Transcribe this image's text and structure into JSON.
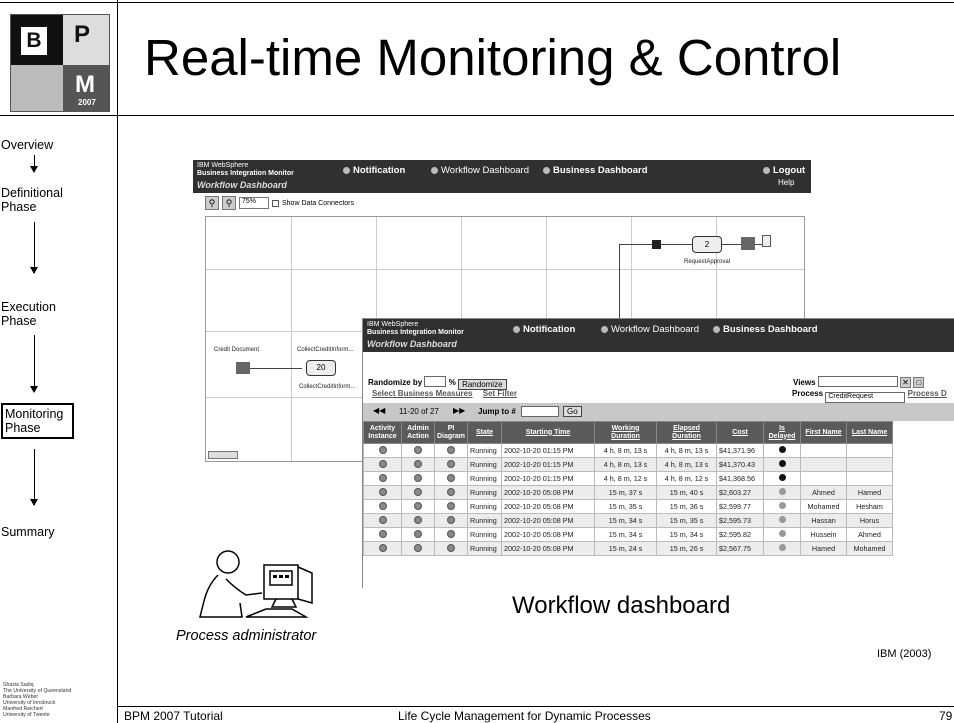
{
  "slide": {
    "title": "Real-time Monitoring & Control",
    "logo": {
      "letters": [
        "B",
        "P",
        "M"
      ],
      "year": "2007"
    },
    "footer": {
      "left": "BPM 2007 Tutorial",
      "center": "Life Cycle Management for Dynamic Processes",
      "page": "79"
    },
    "credits": [
      "Shazia Sadiq",
      "The University of Queensland",
      "Barbara Weber",
      "University of Innsbruck",
      "Manfred Reichert",
      "University of Twente"
    ],
    "caption_dashboard": "Workflow dashboard",
    "caption_admin": "Process administrator",
    "source": "IBM  (2003)"
  },
  "sidebar": {
    "items": [
      {
        "label": "Overview"
      },
      {
        "label": "Definitional Phase"
      },
      {
        "label": "Execution Phase"
      },
      {
        "label": "Monitoring Phase",
        "active": true
      },
      {
        "label": "Summary"
      }
    ]
  },
  "diagram_window": {
    "brand_line1": "IBM WebSphere",
    "brand_line2": "Business Integration Monitor",
    "subtitle": "Workflow Dashboard",
    "tabs": [
      "Notification",
      "Workflow Dashboard",
      "Business Dashboard"
    ],
    "logout": "Logout",
    "help": "Help",
    "zoom": "75%",
    "show_data_connectors": "Show Data Connectors",
    "nodes": {
      "credit_document": "Credit Document",
      "collect_credit_info": "CollectCreditInform...",
      "collect_count": "20",
      "request_approval": "RequestApproval",
      "approval_count": "2"
    }
  },
  "dashboard_window": {
    "brand_line1": "IBM WebSphere",
    "brand_line2": "Business Integration Monitor",
    "subtitle": "Workflow Dashboard",
    "tabs": [
      "Notification",
      "Workflow Dashboard",
      "Business Dashboard"
    ],
    "randomize_by_label": "Randomize by",
    "randomize_unit": "%",
    "randomize_button": "Randomize",
    "select_measures": "Select Business Measures",
    "set_filter": "Set Filter",
    "views_label": "Views",
    "process_label": "Process",
    "process_value": "CreditRequest",
    "process_link": "Process D",
    "pager_range": "11-20 of 27",
    "jump_to": "Jump to #",
    "go": "Go",
    "columns": [
      "Activity Instance",
      "Admin Action",
      "PI Diagram",
      "State",
      "Starting Time",
      "Working Duration",
      "Elapsed Duration",
      "Cost",
      "Is Delayed",
      "First Name",
      "Last Name"
    ],
    "rows": [
      {
        "state": "Running",
        "start": "2002-10-20 01:15 PM",
        "working": "4 h, 8 m, 13 s",
        "elapsed": "4 h, 8 m, 13 s",
        "cost": "$41,371.96",
        "delayed": true,
        "first": "",
        "last": ""
      },
      {
        "state": "Running",
        "start": "2002-10-20 01:15 PM",
        "working": "4 h, 8 m, 13 s",
        "elapsed": "4 h, 8 m, 13 s",
        "cost": "$41,370.43",
        "delayed": true,
        "first": "",
        "last": ""
      },
      {
        "state": "Running",
        "start": "2002-10-20 01:15 PM",
        "working": "4 h, 8 m, 12 s",
        "elapsed": "4 h, 8 m, 12 s",
        "cost": "$41,368.56",
        "delayed": true,
        "first": "",
        "last": ""
      },
      {
        "state": "Running",
        "start": "2002-10-20 05:08 PM",
        "working": "15 m, 37 s",
        "elapsed": "15 m, 40 s",
        "cost": "$2,603.27",
        "delayed": false,
        "first": "Ahmed",
        "last": "Hamed"
      },
      {
        "state": "Running",
        "start": "2002-10-20 05:08 PM",
        "working": "15 m, 35 s",
        "elapsed": "15 m, 36 s",
        "cost": "$2,599.77",
        "delayed": false,
        "first": "Mohamed",
        "last": "Hesham"
      },
      {
        "state": "Running",
        "start": "2002-10-20 05:08 PM",
        "working": "15 m, 34 s",
        "elapsed": "15 m, 35 s",
        "cost": "$2,595.73",
        "delayed": false,
        "first": "Hassan",
        "last": "Horus"
      },
      {
        "state": "Running",
        "start": "2002-10-20 05:08 PM",
        "working": "15 m, 34 s",
        "elapsed": "15 m, 34 s",
        "cost": "$2,595.82",
        "delayed": false,
        "first": "Hussein",
        "last": "Ahmed"
      },
      {
        "state": "Running",
        "start": "2002-10-20 05:08 PM",
        "working": "15 m, 24 s",
        "elapsed": "15 m, 26 s",
        "cost": "$2,567.75",
        "delayed": false,
        "first": "Hamed",
        "last": "Mohamed"
      }
    ]
  }
}
